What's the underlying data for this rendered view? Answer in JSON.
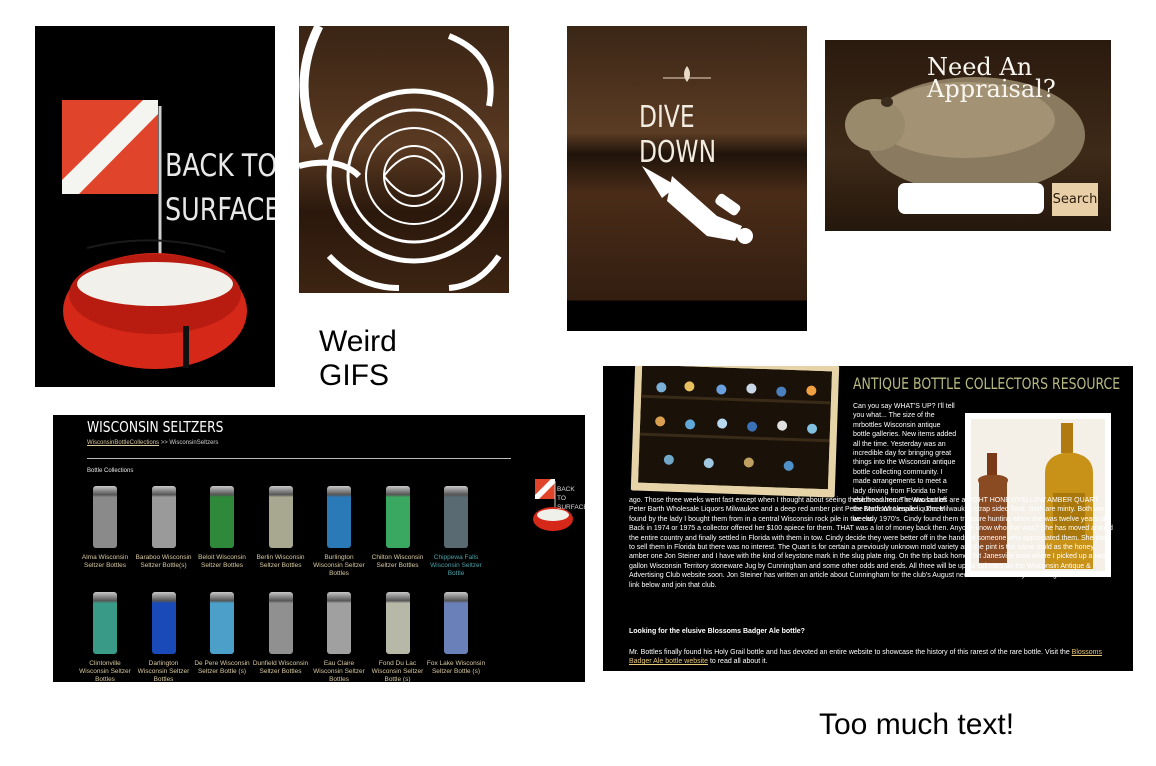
{
  "panel_back_to_surface": {
    "line1": "BACK TO",
    "line2": "SURFACE"
  },
  "panel_dive_down": {
    "title": "DIVE DOWN"
  },
  "panel_appraisal": {
    "title": "Need An Appraisal?",
    "search_button": "Search",
    "search_value": ""
  },
  "annotations": {
    "gifs": "Weird GIFS",
    "text": "Too much text!"
  },
  "seltzers": {
    "title": "WISCONSIN SELTZERS",
    "breadcrumb_link": "WisconsinBottleCollections",
    "breadcrumb_sep": ">>",
    "breadcrumb_current": "WisconsinSeltzers",
    "section_label": "Bottle Collections",
    "side_badge": "BACK TO SURFACE",
    "row1": [
      {
        "label": "Alma Wisconsin Seltzer Bottles",
        "color": "#8a8a8a"
      },
      {
        "label": "Baraboo Wisconsin Seltzer Bottle(s)",
        "color": "#9a9a9a"
      },
      {
        "label": "Beloit Wisconsin Seltzer Bottles",
        "color": "#2e8a3a"
      },
      {
        "label": "Berlin Wisconsin Seltzer Bottles",
        "color": "#a8a890"
      },
      {
        "label": "Burlington Wisconsin Seltzer Bottles",
        "color": "#2a7ab8"
      },
      {
        "label": "Chilton Wisconsin Seltzer Bottles",
        "color": "#3aa860"
      },
      {
        "label": "Chippewa Falls Wisconsin Seltzer Bottle",
        "color": "#5a6a72"
      }
    ],
    "row2": [
      {
        "label": "Clintonville Wisconsin Seltzer Bottles",
        "color": "#3a9a88"
      },
      {
        "label": "Darlington Wisconsin Seltzer Bottles",
        "color": "#1a4ab8"
      },
      {
        "label": "De Pere Wisconsin Seltzer Bottle (s)",
        "color": "#4aa0c8"
      },
      {
        "label": "Dunfield Wisconsin Seltzer Bottles",
        "color": "#909090"
      },
      {
        "label": "Eau Claire Wisconsin Seltzer Bottles",
        "color": "#a0a0a0"
      },
      {
        "label": "Fond Du Lac Wisconsin Seltzer Bottle (s)",
        "color": "#b8b8a8"
      },
      {
        "label": "Fox Lake Wisconsin Seltzer Bottle (s)",
        "color": "#6a80b8"
      }
    ]
  },
  "resource": {
    "title": "ANTIQUE BOTTLE COLLECTORS RESOURCE",
    "col_paragraph": "Can you say WHAT'S UP? I'll tell you what... The size of the mrbottles Wisconsin antique bottle galleries. New items added all the time. Yesterday was an incredible day for bringing great things into the Wisconsin antique bottle collecting community. I made arrangements to meet a lady driving from Florida to her childhood home in Wausau off the Madison turnpike... Three weeks",
    "full_paragraph": "ago. Those three weeks went fast except when I thought about seeing these treasures. The two bottles are a LIGHT HONEY/YELLOW AMBER QUART Peter Barth Wholesale Liquors Milwaukee and a deep red amber pint Peter Barth Wholesale liquors Milwaukee strap sided flask. Both are minty. Both were found by the lady I bought them from in a central Wisconsin rock pile in the early 1970's. Cindy found them treasure hunting when she was twelve years old. Back in 1974 or 1975 a collector offered her $100 apiece for them. THAT was a lot of money back then. Anyone know who that was? She has moved around the entire country and finally settled in Florida with them in tow. Cindy decide they were better off in the hands of someone who appreciated them. She tried to sell them in Florida but there was no interest. The Quart is for certain a previously unknown mold variety and the pint is the same mold as the honey amber one Jon Steiner and I have with the kind of keystone mark in the slug plate ring. On the trip back home I hit Janesville area where I picked up a two gallon Wisconsin Territory stoneware Jug by Cunningham and some other odds and ends. All three will be up as spinners on the Wisconsin Antique & Advertising Club website soon. Jon Steiner has written an article about Cunningham for the club's August newsletter. What are you waiting for... Follow the link below and join that club.",
    "subheading": "Looking for the elusive Blossoms Badger Ale bottle?",
    "last_paragraph_start": "Mr. Bottles finally found his Holy Grail bottle and has devoted an entire website to showcase the history of this rarest of the rare bottle. Visit the ",
    "last_paragraph_link": "Blossoms Badger Ale bottle website",
    "last_paragraph_end": " to read all about it."
  }
}
